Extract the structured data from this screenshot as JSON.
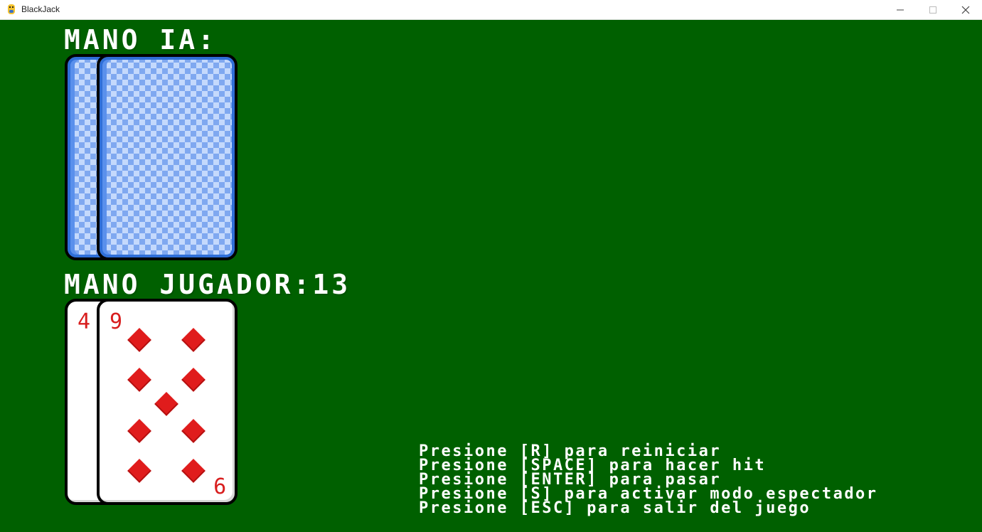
{
  "window": {
    "title": "BlackJack",
    "minimize_icon": "minimize-icon",
    "maximize_icon": "maximize-icon",
    "close_icon": "close-icon"
  },
  "colors": {
    "table_green": "#006000",
    "text": "#ffffff",
    "card_red": "#d81e1e",
    "card_back_blue": "#7fa8f0"
  },
  "dealer": {
    "label": "MANO IA:",
    "cards": [
      {
        "face": "down"
      },
      {
        "face": "down"
      }
    ]
  },
  "player": {
    "label": "MANO JUGADOR:",
    "score": "13",
    "cards": [
      {
        "rank": "4",
        "suit": "diamonds"
      },
      {
        "rank": "9",
        "suit": "diamonds"
      }
    ]
  },
  "instructions": [
    "Presione [R] para reiniciar",
    "Presione [SPACE] para hacer hit",
    "Presione [ENTER] para pasar",
    "Presione [S] para activar modo espectador",
    "Presione [ESC] para salir del juego"
  ]
}
